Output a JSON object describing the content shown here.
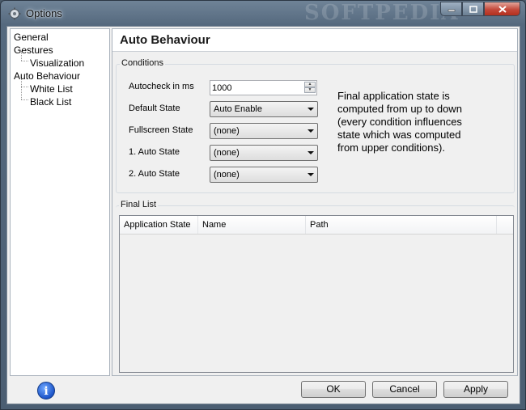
{
  "window": {
    "title": "Options",
    "watermark": "SOFTPEDIA"
  },
  "tree": {
    "items": [
      {
        "label": "General",
        "level": 0
      },
      {
        "label": "Gestures",
        "level": 0
      },
      {
        "label": "Visualization",
        "level": 1
      },
      {
        "label": "Auto Behaviour",
        "level": 0
      },
      {
        "label": "White List",
        "level": 1
      },
      {
        "label": "Black List",
        "level": 1
      }
    ]
  },
  "page": {
    "title": "Auto Behaviour"
  },
  "conditions": {
    "label": "Conditions",
    "autocheck_label": "Autocheck in ms",
    "autocheck_value": "1000",
    "default_state_label": "Default State",
    "default_state_value": "Auto Enable",
    "fullscreen_state_label": "Fullscreen State",
    "fullscreen_state_value": "(none)",
    "auto_state_1_label": "1. Auto State",
    "auto_state_1_value": "(none)",
    "auto_state_2_label": "2. Auto State",
    "auto_state_2_value": "(none)",
    "note": "Final application state is computed from up to down (every condition influences state which was computed from upper conditions)."
  },
  "final_list": {
    "label": "Final List",
    "columns": [
      "Application State",
      "Name",
      "Path"
    ],
    "rows": []
  },
  "buttons": {
    "ok": "OK",
    "cancel": "Cancel",
    "apply": "Apply"
  },
  "icons": {
    "app": "gear-icon",
    "info": "info-icon"
  }
}
